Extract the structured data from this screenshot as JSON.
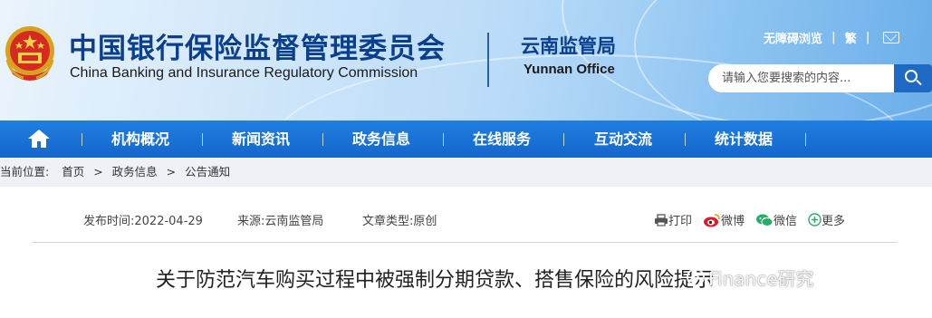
{
  "header": {
    "title_cn": "中国银行保险监督管理委员会",
    "title_en": "China Banking and Insurance Regulatory Commission",
    "office_cn": "云南监管局",
    "office_en": "Yunnan Office",
    "accessible_link": "无障碍浏览",
    "traditional_link": "繁",
    "search_placeholder": "请输入您要搜索的内容..."
  },
  "nav": {
    "items": [
      "机构概况",
      "新闻资讯",
      "政务信息",
      "在线服务",
      "互动交流",
      "统计数据"
    ]
  },
  "breadcrumb": {
    "prefix": "当前位置:",
    "items": [
      "首页",
      "政务信息",
      "公告通知"
    ],
    "separator": ">"
  },
  "article": {
    "publish_time": "发布时间:2022-04-29",
    "source": "来源:云南监管局",
    "type": "文章类型:原创",
    "title": "关于防范汽车购买过程中被强制分期贷款、搭售保险的风险提示"
  },
  "tools": {
    "print": "打印",
    "weibo": "微博",
    "wechat": "微信",
    "more": "更多"
  },
  "watermark": "Finance研究",
  "colors": {
    "nav_blue": "#1566cc",
    "title_blue": "#0b3f8e",
    "search_button": "#1d69c4"
  }
}
